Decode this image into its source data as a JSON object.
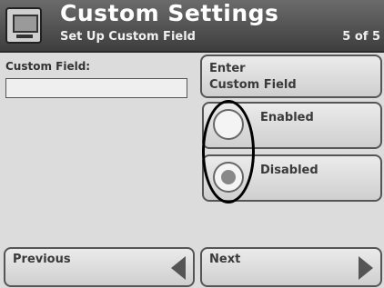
{
  "header": {
    "title": "Custom Settings",
    "subtitle": "Set Up Custom Field",
    "page_indicator": "5 of 5"
  },
  "field": {
    "label": "Custom Field:",
    "value": ""
  },
  "enter_button": {
    "line1": "Enter",
    "line2": "Custom Field"
  },
  "options": [
    {
      "label": "Enabled",
      "selected": false
    },
    {
      "label": "Disabled",
      "selected": true
    }
  ],
  "nav": {
    "previous": "Previous",
    "next": "Next"
  },
  "icons": {
    "app": "monitor-icon",
    "previous": "arrow-left-icon",
    "next": "arrow-right-icon"
  }
}
